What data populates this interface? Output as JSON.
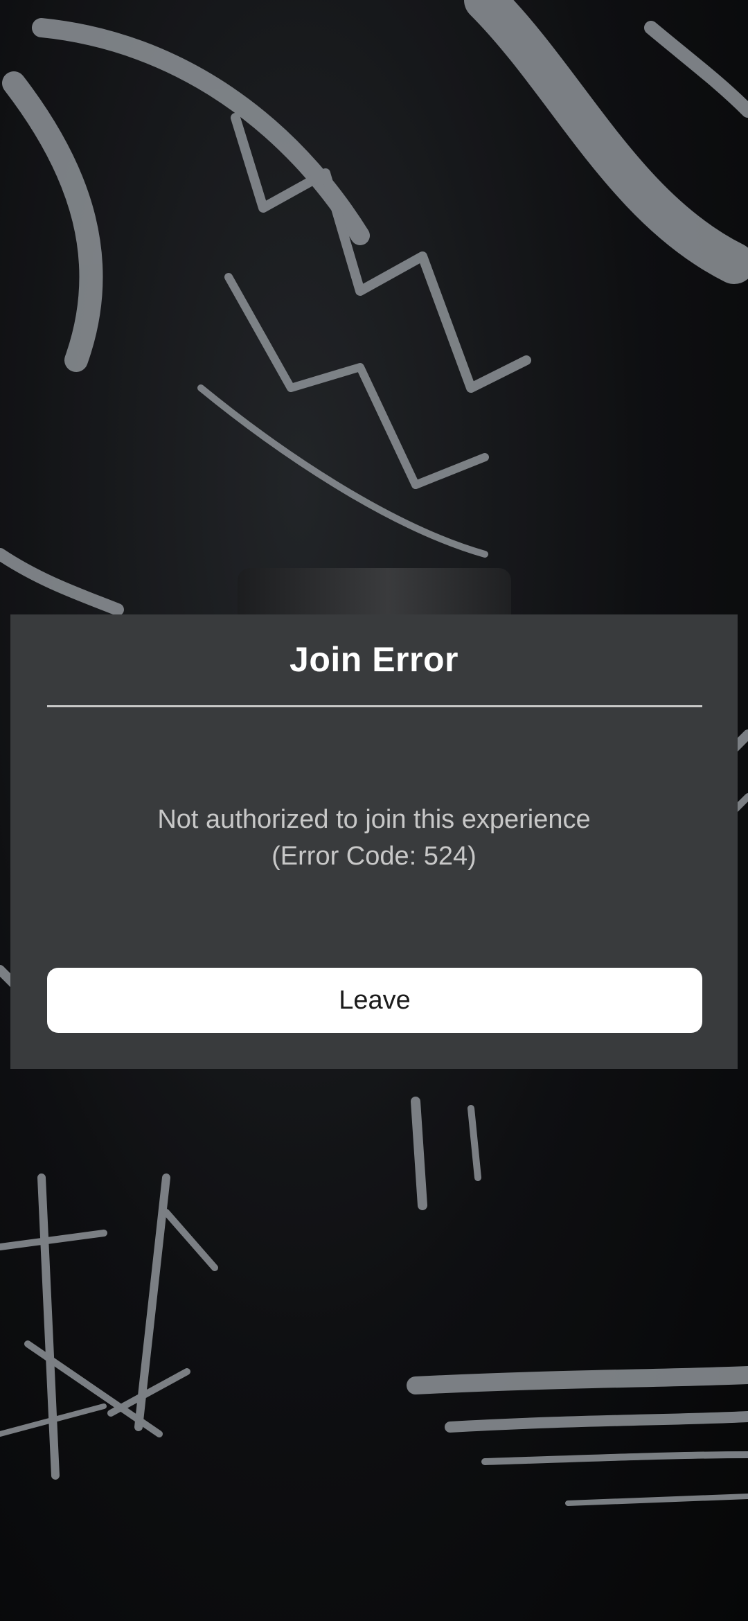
{
  "background": {
    "description_icon": "graffiti-artwork",
    "colors": {
      "dark": "#0c0d0f",
      "stroke": "#b9bfc4"
    }
  },
  "dialog": {
    "title": "Join Error",
    "message_line1": "Not authorized to join this experience",
    "message_line2": "(Error Code: 524)",
    "leave_label": "Leave",
    "colors": {
      "panel": "#393b3d",
      "title": "#ffffff",
      "message": "#c8c8c8",
      "button_bg": "#ffffff",
      "button_text": "#1b1b1b"
    }
  }
}
